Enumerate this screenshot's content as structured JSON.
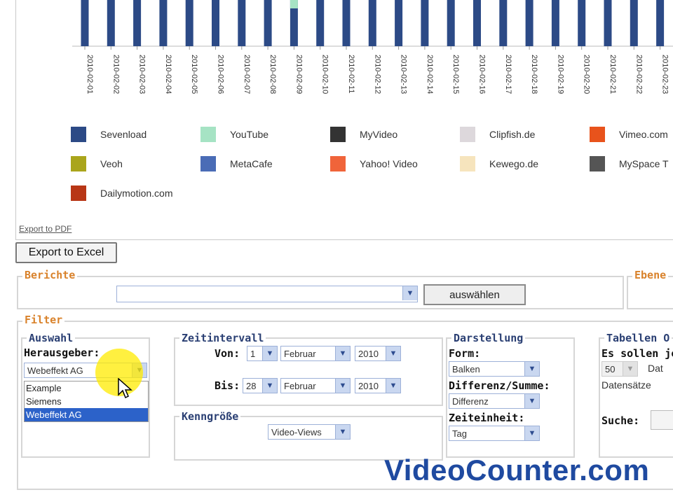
{
  "chart_data": {
    "type": "bar",
    "categories": [
      "2010-02-01",
      "2010-02-02",
      "2010-02-03",
      "2010-02-04",
      "2010-02-05",
      "2010-02-06",
      "2010-02-07",
      "2010-02-08",
      "2010-02-09",
      "2010-02-10",
      "2010-02-11",
      "2010-02-12",
      "2010-02-13",
      "2010-02-14",
      "2010-02-15",
      "2010-02-16",
      "2010-02-17",
      "2010-02-18",
      "2010-02-19",
      "2010-02-20",
      "2010-02-21",
      "2010-02-22",
      "2010-02-23"
    ],
    "legend": [
      {
        "name": "Sevenload",
        "color": "#2c4a86"
      },
      {
        "name": "YouTube",
        "color": "#a6e3c4"
      },
      {
        "name": "MyVideo",
        "color": "#333333"
      },
      {
        "name": "Clipfish.de",
        "color": "#ddd8dc"
      },
      {
        "name": "Vimeo.com",
        "color": "#e8531c"
      },
      {
        "name": "Veoh",
        "color": "#aaa51c"
      },
      {
        "name": "MetaCafe",
        "color": "#4a6cb6"
      },
      {
        "name": "Yahoo! Video",
        "color": "#f0643a"
      },
      {
        "name": "Kewego.de",
        "color": "#f6e4bd"
      },
      {
        "name": "MySpace T",
        "color": "#555555"
      },
      {
        "name": "Dailymotion.com",
        "color": "#b83616"
      }
    ],
    "bar_color": "#2c4a86",
    "highlight_color": "#a6e3c4"
  },
  "export_pdf_label": "Export to PDF",
  "export_excel_label": "Export to Excel",
  "reports": {
    "title": "Berichte",
    "select_value": "",
    "select_button": "auswählen",
    "levels_title": "Ebene"
  },
  "filter": {
    "title": "Filter",
    "selection": {
      "title": "Auswahl",
      "publisher_label": "Herausgeber:",
      "publisher_value": "Webeffekt AG",
      "options": [
        "Example",
        "Siemens",
        "Webeffekt AG"
      ],
      "selected_index": 2
    },
    "interval": {
      "title": "Zeitintervall",
      "from_label": "Von:",
      "from_day": "1",
      "from_month": "Februar",
      "from_year": "2010",
      "to_label": "Bis:",
      "to_day": "28",
      "to_month": "Februar",
      "to_year": "2010"
    },
    "metric": {
      "title": "Kenngröße",
      "value": "Video-Views"
    },
    "display": {
      "title": "Darstellung",
      "form_label": "Form:",
      "form_value": "Balken",
      "diff_label": "Differenz/Summe:",
      "diff_value": "Differenz",
      "unit_label": "Zeiteinheit:",
      "unit_value": "Tag"
    },
    "table": {
      "title": "Tabellen O",
      "rows_label": "Es sollen je",
      "rows_value": "50",
      "rows_suffix": "Dat",
      "records_label": "Datensätze",
      "search_label": "Suche:"
    }
  },
  "watermark": "VideoCounter.com"
}
